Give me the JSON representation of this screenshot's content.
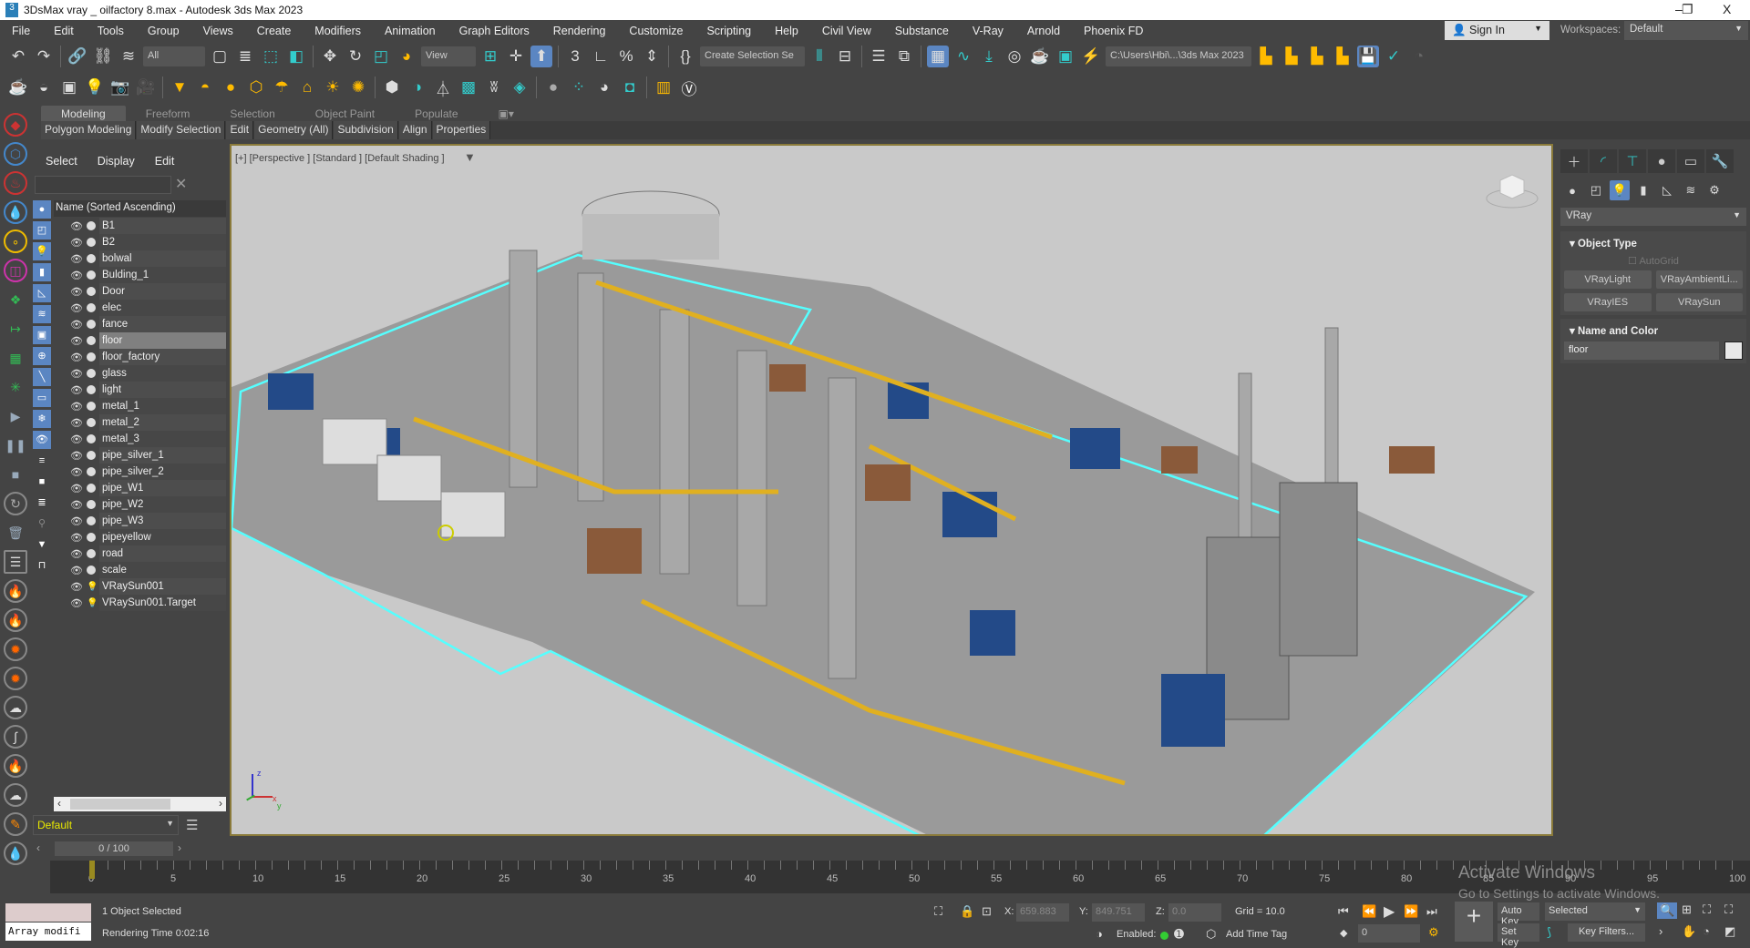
{
  "window": {
    "title": "3DsMax vray _ oilfactory 8.max - Autodesk 3ds Max 2023",
    "minimize": "–",
    "restore": "❐",
    "close": "X"
  },
  "menu": [
    "File",
    "Edit",
    "Tools",
    "Group",
    "Views",
    "Create",
    "Modifiers",
    "Animation",
    "Graph Editors",
    "Rendering",
    "Customize",
    "Scripting",
    "Help",
    "Civil View",
    "Substance",
    "V-Ray",
    "Arnold",
    "Phoenix FD"
  ],
  "account": {
    "sign_in": "Sign In",
    "workspaces_label": "Workspaces:",
    "workspace": "Default"
  },
  "toolbar": {
    "selection_filter": "All",
    "ref_coord": "View",
    "selection_set": "Create Selection Se",
    "project_path": "C:\\Users\\Hbi\\...\\3ds Max 2023"
  },
  "ribbon": {
    "tabs": [
      "Modeling",
      "Freeform",
      "Selection",
      "Object Paint",
      "Populate"
    ],
    "panels": [
      "Polygon Modeling",
      "Modify Selection",
      "Edit",
      "Geometry (All)",
      "Subdivision",
      "Align",
      "Properties"
    ]
  },
  "explorer": {
    "menu": [
      "Select",
      "Display",
      "Edit"
    ],
    "search": "",
    "column": "Name (Sorted Ascending)",
    "items": [
      "B1",
      "B2",
      "bolwal",
      "Bulding_1",
      "Door",
      "elec",
      "fance",
      "floor",
      "floor_factory",
      "glass",
      "light",
      "metal_1",
      "metal_2",
      "metal_3",
      "pipe_silver_1",
      "pipe_silver_2",
      "pipe_W1",
      "pipe_W2",
      "pipe_W3",
      "pipeyellow",
      "road",
      "scale",
      "VRaySun001",
      "VRaySun001.Target"
    ],
    "selected": "floor",
    "layer": "Default"
  },
  "viewport": {
    "label": "[+] [Perspective ] [Standard ] [Default Shading ]",
    "axes": {
      "x": "x",
      "y": "y",
      "z": "z"
    }
  },
  "command_panel": {
    "category": "VRay",
    "object_type": "Object Type",
    "autogrid": "AutoGrid",
    "buttons": [
      "VRayLight",
      "VRayAmbientLi...",
      "VRayIES",
      "VRaySun"
    ],
    "name_and_color": "Name and Color",
    "object_name": "floor",
    "object_color": "#e8e8e8"
  },
  "timeline": {
    "frame": "0 / 100",
    "ticks": [
      0,
      5,
      10,
      15,
      20,
      25,
      30,
      35,
      40,
      45,
      50,
      55,
      60,
      65,
      70,
      75,
      80,
      85,
      90,
      95,
      100
    ]
  },
  "status": {
    "listener": "Array modifi",
    "selection": "1 Object Selected",
    "render_time": "Rendering Time  0:02:16",
    "x_label": "X:",
    "x": "659.883",
    "y_label": "Y:",
    "y": "849.751",
    "z_label": "Z:",
    "z": "0.0",
    "grid": "Grid = 10.0",
    "enabled": "Enabled:",
    "time_tag": "Add Time Tag",
    "auto_key": "Auto Key",
    "set_key": "Set Key",
    "key_mode": "Selected",
    "key_filters": "Key Filters...",
    "frame": "0"
  },
  "watermark": {
    "line1": "Activate Windows",
    "line2": "Go to Settings to activate Windows."
  }
}
